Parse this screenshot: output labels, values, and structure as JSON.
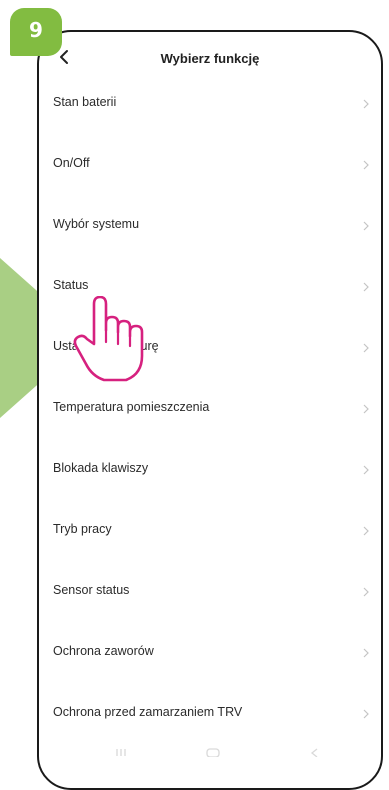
{
  "step_badge": "9",
  "header": {
    "title": "Wybierz funkcję",
    "back_icon": "chevron-left-icon"
  },
  "menu": {
    "chevron_icon": "chevron-right-icon",
    "items": [
      {
        "label": "Stan baterii"
      },
      {
        "label": "On/Off"
      },
      {
        "label": "Wybór systemu"
      },
      {
        "label": "Status"
      },
      {
        "label": "Ustaw temperaturę"
      },
      {
        "label": "Temperatura pomieszczenia"
      },
      {
        "label": "Blokada klawiszy"
      },
      {
        "label": "Tryb pracy"
      },
      {
        "label": "Sensor status"
      },
      {
        "label": "Ochrona zaworów"
      },
      {
        "label": "Ochrona przed zamarzaniem TRV"
      }
    ]
  },
  "overlay": {
    "hand_icon": "pointing-hand-icon",
    "arrow_icon": "arrow-right-icon"
  },
  "colors": {
    "accent_green": "#82bc41",
    "hand_pink": "#d6217f",
    "frame": "#1a1a1a"
  }
}
